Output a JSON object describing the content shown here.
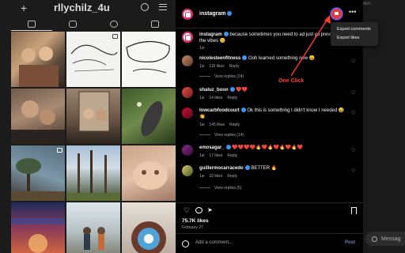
{
  "profile": {
    "username": "rllychilz_4u",
    "plus_icon": "plus-icon",
    "tabs": [
      "grid-icon",
      "reels-icon",
      "reposts-icon",
      "tagged-icon"
    ]
  },
  "right_strip": {
    "ghost_switch": "Switch",
    "messages_label": "Messag"
  },
  "post": {
    "author": "instagram",
    "caption_author": "instagram",
    "caption": "because sometimes you need to ad just yo preview for the vibes 😊",
    "caption_time": "1w",
    "likes": "75.7K likes",
    "date": "February 27",
    "add_comment_placeholder": "Add a comment...",
    "post_label": "Post"
  },
  "extension_menu": {
    "items": [
      "Export comments",
      "Export likes"
    ]
  },
  "annotation": {
    "label": "One Click",
    "color": "#ff3b2f"
  },
  "comments": [
    {
      "user": "nicolesteenfitness",
      "text": "Ooh learned something new 😄",
      "time": "1w",
      "likes": "116 likes",
      "reply": "Reply",
      "view_replies": "View replies (24)"
    },
    {
      "user": "shaluz_boon",
      "text": "❤️❤️",
      "time": "1w",
      "likes": "14 likes",
      "reply": "Reply",
      "view_replies": ""
    },
    {
      "user": "lowcarbfoodcourt",
      "text": "Ok this is something I didn't know I needed 😂👏",
      "time": "1w",
      "likes": "145 likes",
      "reply": "Reply",
      "view_replies": "View replies (14)"
    },
    {
      "user": "emosagar_",
      "text": "❤️❤️❤️❤️🔥❤️🔥❤️🔥❤️🔥❤️",
      "time": "1w",
      "likes": "17 likes",
      "reply": "Reply",
      "view_replies": ""
    },
    {
      "user": "guillermocarracedo",
      "text": "BETTER 🔥",
      "time": "1w",
      "likes": "32 likes",
      "reply": "Reply",
      "view_replies": "View replies (5)"
    }
  ],
  "colors": {
    "background": "#000000",
    "accent_blue": "#3897f0",
    "extension_red": "#e23a3a",
    "muted_text": "#a8a8a8"
  }
}
